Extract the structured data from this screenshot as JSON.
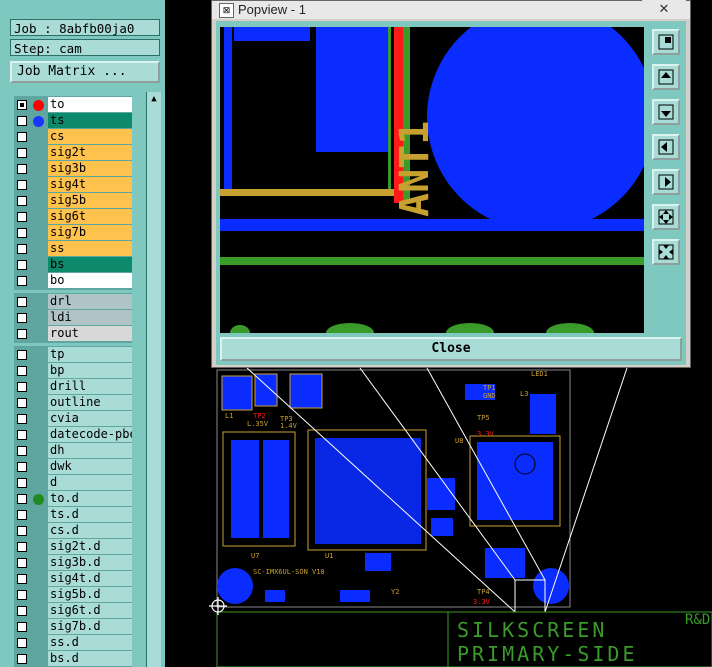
{
  "job": {
    "job_label": "Job : 8abfb00ja0",
    "step_label": "Step: cam",
    "matrix_button": "Job Matrix ..."
  },
  "layers": {
    "signal": [
      {
        "name": "to",
        "color": "#ffffff",
        "dot": "#ff0000",
        "checked": true
      },
      {
        "name": "ts",
        "color": "#0d8a6c",
        "dot": "#1a35ff",
        "checked": false
      },
      {
        "name": "cs",
        "color": "#ffc34d",
        "checked": false
      },
      {
        "name": "sig2t",
        "color": "#ffc34d",
        "checked": false
      },
      {
        "name": "sig3b",
        "color": "#ffc34d",
        "checked": false
      },
      {
        "name": "sig4t",
        "color": "#ffc34d",
        "checked": false
      },
      {
        "name": "sig5b",
        "color": "#ffc34d",
        "checked": false
      },
      {
        "name": "sig6t",
        "color": "#ffc34d",
        "checked": false
      },
      {
        "name": "sig7b",
        "color": "#ffc34d",
        "checked": false
      },
      {
        "name": "ss",
        "color": "#ffc34d",
        "checked": false
      },
      {
        "name": "bs",
        "color": "#0d8a6c",
        "checked": false
      },
      {
        "name": "bo",
        "color": "#ffffff",
        "checked": false
      }
    ],
    "drill": [
      {
        "name": "drl",
        "color": "#b0c4c8"
      },
      {
        "name": "ldi",
        "color": "#b0c4c8"
      },
      {
        "name": "rout",
        "color": "#d8d8d8"
      }
    ],
    "misc": [
      {
        "name": "tp"
      },
      {
        "name": "bp"
      },
      {
        "name": "drill"
      },
      {
        "name": "outline"
      },
      {
        "name": "cvia"
      },
      {
        "name": "datecode-pbe"
      },
      {
        "name": "dh"
      },
      {
        "name": "dwk"
      },
      {
        "name": "d"
      },
      {
        "name": "to.d",
        "dot": "#1f8a1f"
      },
      {
        "name": "ts.d"
      },
      {
        "name": "cs.d"
      },
      {
        "name": "sig2t.d"
      },
      {
        "name": "sig3b.d"
      },
      {
        "name": "sig4t.d"
      },
      {
        "name": "sig5b.d"
      },
      {
        "name": "sig6t.d"
      },
      {
        "name": "sig7b.d"
      },
      {
        "name": "ss.d"
      },
      {
        "name": "bs.d"
      }
    ],
    "misc_color": "#a9dcd6"
  },
  "popview": {
    "title": "Popview - 1",
    "close_x": "✕",
    "close_button": "Close",
    "antenna_label": "ANT1",
    "tools": [
      "zoom-fit-icon",
      "pan-up-icon",
      "pan-down-icon",
      "pan-left-icon",
      "pan-right-icon",
      "zoom-in-icon",
      "zoom-out-icon"
    ]
  },
  "board": {
    "silk_line1": "SILKSCREEN",
    "silk_line2": "PRIMARY-SIDE",
    "corner_text": "R&D",
    "board_text": "SC-IMX6UL-SON V10",
    "ref_labels": [
      "L1",
      "TP2",
      "TP3",
      "L.35V",
      "1.4V",
      "U8",
      "TP1",
      "GND",
      "TP5",
      "3.3V",
      "U7",
      "U1",
      "Y2",
      "TP4",
      "3.3V",
      "LED1",
      "L3"
    ]
  },
  "colors": {
    "copper_blue": "#0a2cff",
    "silk_yellow": "#c8a030",
    "trace_green": "#3a9a2a",
    "red": "#ff1a1a"
  }
}
